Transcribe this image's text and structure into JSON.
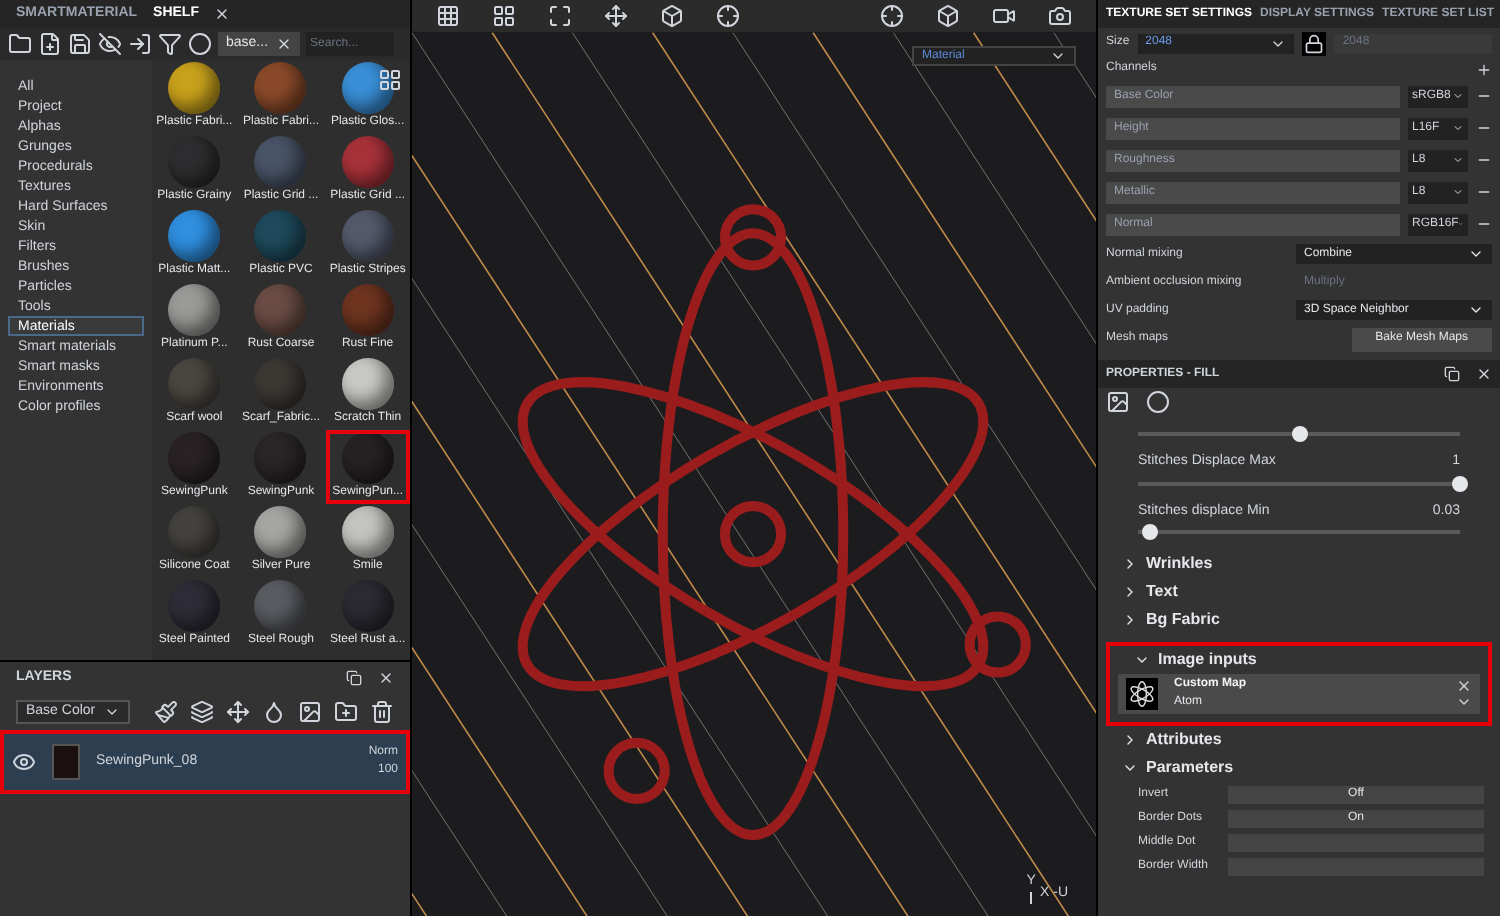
{
  "shelf": {
    "tabs": [
      {
        "label": "SMARTMATERIAL",
        "selected": false
      },
      {
        "label": "SHELF",
        "selected": true
      }
    ],
    "filter_tag": "base...",
    "search": {
      "placeholder": "Search..."
    },
    "categories": [
      {
        "label": "All",
        "selected": false
      },
      {
        "label": "Project",
        "selected": false
      },
      {
        "label": "Alphas",
        "selected": false
      },
      {
        "label": "Grunges",
        "selected": false
      },
      {
        "label": "Procedurals",
        "selected": false
      },
      {
        "label": "Textures",
        "selected": false
      },
      {
        "label": "Hard Surfaces",
        "selected": false
      },
      {
        "label": "Skin",
        "selected": false
      },
      {
        "label": "Filters",
        "selected": false
      },
      {
        "label": "Brushes",
        "selected": false
      },
      {
        "label": "Particles",
        "selected": false
      },
      {
        "label": "Tools",
        "selected": false
      },
      {
        "label": "Materials",
        "selected": true
      },
      {
        "label": "Smart materials",
        "selected": false
      },
      {
        "label": "Smart masks",
        "selected": false
      },
      {
        "label": "Environments",
        "selected": false
      },
      {
        "label": "Color profiles",
        "selected": false
      }
    ],
    "materials": [
      {
        "label": "Plastic Fabri...",
        "color": "#c9a21c",
        "selected": false
      },
      {
        "label": "Plastic Fabri...",
        "color": "#8a4a2a",
        "selected": false
      },
      {
        "label": "Plastic Glos...",
        "color": "#3a8fd8",
        "selected": false
      },
      {
        "label": "Plastic Grainy",
        "color": "#2e2e30",
        "selected": false
      },
      {
        "label": "Plastic Grid ...",
        "color": "#4a5468",
        "selected": false
      },
      {
        "label": "Plastic Grid ...",
        "color": "#a8323a",
        "selected": false
      },
      {
        "label": "Plastic Matt...",
        "color": "#2f8fe0",
        "selected": false
      },
      {
        "label": "Plastic PVC",
        "color": "#1e4a5c",
        "selected": false
      },
      {
        "label": "Plastic Stripes",
        "color": "#545a6c",
        "selected": false
      },
      {
        "label": "Platinum P...",
        "color": "#9a9a98",
        "selected": false
      },
      {
        "label": "Rust Coarse",
        "color": "#6a4c44",
        "selected": false
      },
      {
        "label": "Rust Fine",
        "color": "#6e3420",
        "selected": false
      },
      {
        "label": "Scarf wool",
        "color": "#4a4640",
        "selected": false
      },
      {
        "label": "Scarf_Fabric...",
        "color": "#3c3834",
        "selected": false
      },
      {
        "label": "Scratch Thin",
        "color": "#c8c8c4",
        "selected": false
      },
      {
        "label": "SewingPunk",
        "color": "#2a2326",
        "selected": false
      },
      {
        "label": "SewingPunk",
        "color": "#2a2628",
        "selected": false
      },
      {
        "label": "SewingPun...",
        "color": "#262224",
        "selected": true
      },
      {
        "label": "Silicone Coat",
        "color": "#44423e",
        "selected": false
      },
      {
        "label": "Silver Pure",
        "color": "#a6a6a4",
        "selected": false
      },
      {
        "label": "Smile",
        "color": "#c4c4c0",
        "selected": false
      },
      {
        "label": "Steel Painted",
        "color": "#2e2c36",
        "selected": false
      },
      {
        "label": "Steel Rough",
        "color": "#5a5c62",
        "selected": false
      },
      {
        "label": "Steel Rust a...",
        "color": "#2c2a32",
        "selected": false
      }
    ]
  },
  "layers": {
    "title": "LAYERS",
    "channel": "Base Color",
    "items": [
      {
        "name": "SewingPunk_08",
        "blend": "Norm",
        "opacity": "100",
        "visible": true,
        "selected": true
      }
    ]
  },
  "viewport": {
    "mode": "Material",
    "axis": {
      "y": "Y",
      "x": "X",
      "u": "-U"
    }
  },
  "texture_set_settings": {
    "tabs": [
      {
        "label": "TEXTURE SET SETTINGS",
        "selected": true
      },
      {
        "label": "DISPLAY SETTINGS",
        "selected": false
      },
      {
        "label": "TEXTURE SET LIST",
        "selected": false
      }
    ],
    "size_label": "Size",
    "size": "2048",
    "size_linked": "2048",
    "channels_label": "Channels",
    "channels": [
      {
        "name": "Base Color",
        "format": "sRGB8"
      },
      {
        "name": "Height",
        "format": "L16F"
      },
      {
        "name": "Roughness",
        "format": "L8"
      },
      {
        "name": "Metallic",
        "format": "L8"
      },
      {
        "name": "Normal",
        "format": "RGB16F"
      }
    ],
    "settings": [
      {
        "label": "Normal mixing",
        "value": "Combine",
        "disabled": false
      },
      {
        "label": "Ambient occlusion mixing",
        "value": "Multiply",
        "disabled": true
      },
      {
        "label": "UV padding",
        "value": "3D Space Neighbor",
        "disabled": false
      }
    ],
    "mesh_maps_label": "Mesh maps",
    "bake_button": "Bake Mesh Maps"
  },
  "properties": {
    "title": "PROPERTIES - FILL",
    "sliders": [
      {
        "level": 0.5
      },
      {
        "label": "Stitches Displace Max",
        "reading": "1",
        "level": 1
      },
      {
        "label": "Stitches displace Min",
        "reading": "0.03",
        "level": 0.04
      }
    ],
    "sections": [
      {
        "label": "Wrinkles",
        "expanded": false
      },
      {
        "label": "Text",
        "expanded": false
      },
      {
        "label": "Bg Fabric",
        "expanded": false
      }
    ],
    "image_inputs": {
      "label": "Image inputs",
      "expanded": true,
      "name": "Custom Map",
      "value": "Atom"
    },
    "attributes": {
      "label": "Attributes",
      "expanded": false
    },
    "parameters": {
      "label": "Parameters",
      "expanded": true,
      "rows": [
        {
          "label": "Invert",
          "value": "Off"
        },
        {
          "label": "Border Dots",
          "value": "On"
        },
        {
          "label": "Middle Dot"
        },
        {
          "label": "Border Width"
        }
      ]
    }
  }
}
